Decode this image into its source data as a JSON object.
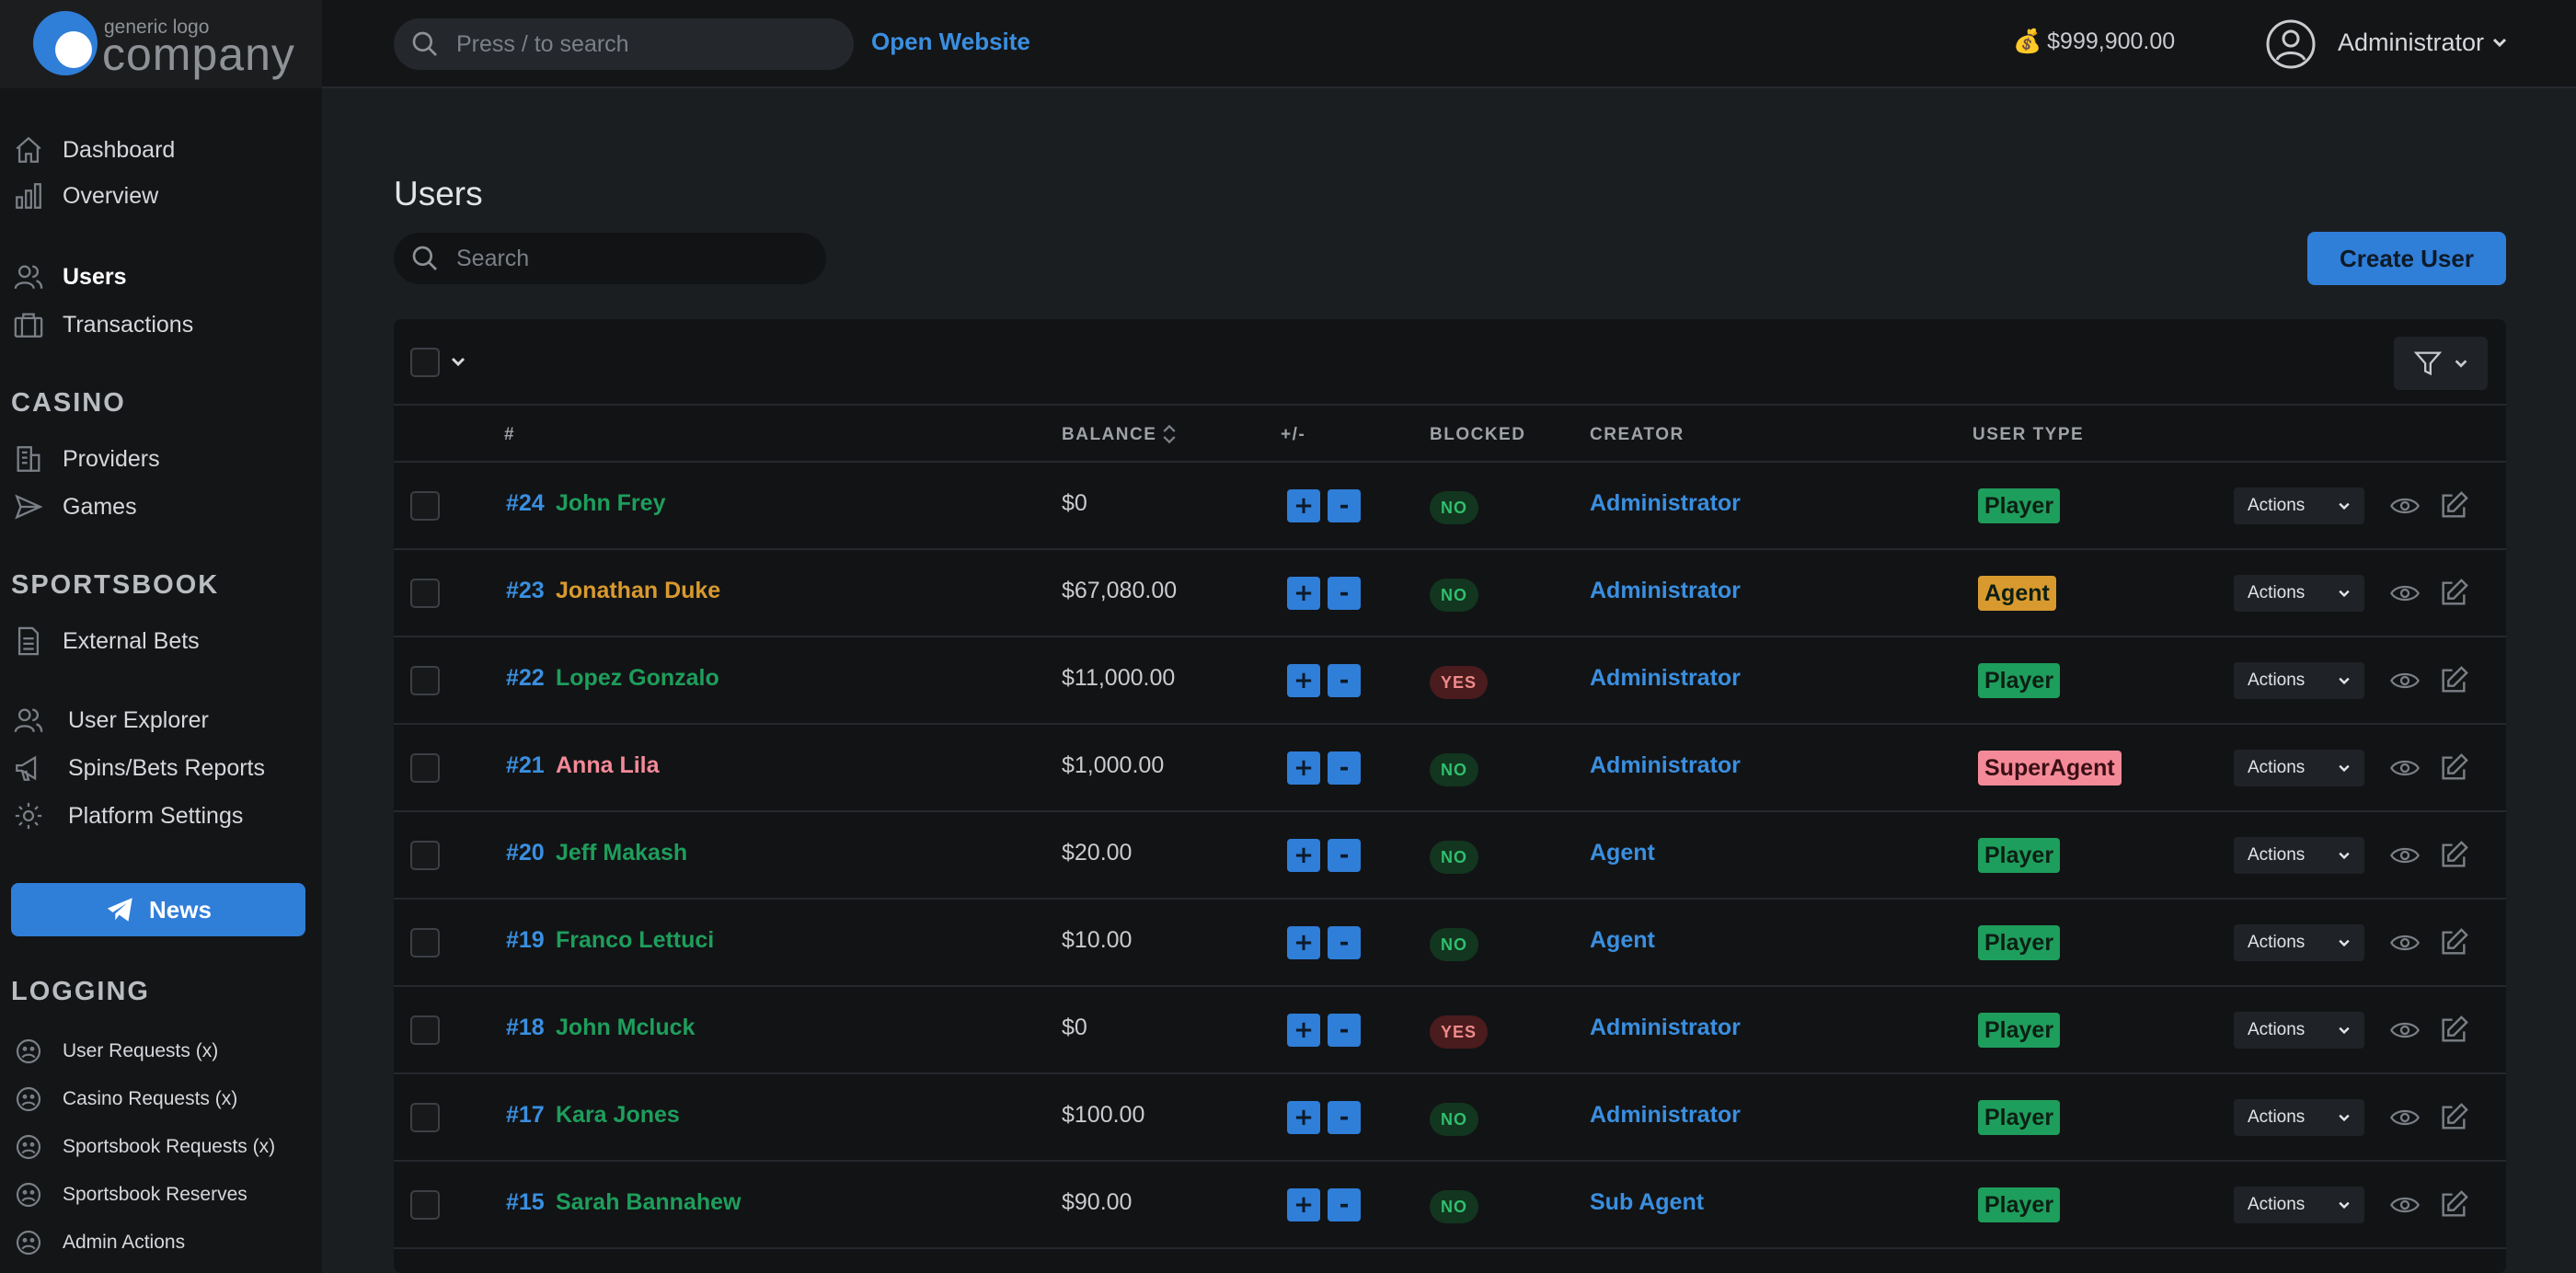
{
  "brand": {
    "small": "generic logo",
    "big": "company"
  },
  "topbar": {
    "search_placeholder": "Press / to search",
    "open_website": "Open Website",
    "balance_icon": "💰",
    "balance": "$999,900.00",
    "user_name": "Administrator"
  },
  "sidebar": {
    "main": [
      {
        "label": "Dashboard",
        "icon": "home-icon"
      },
      {
        "label": "Overview",
        "icon": "bar-chart-icon"
      },
      {
        "label": "Users",
        "icon": "users-icon",
        "active": true
      },
      {
        "label": "Transactions",
        "icon": "briefcase-icon"
      }
    ],
    "casino_title": "CASINO",
    "casino": [
      {
        "label": "Providers",
        "icon": "building-icon"
      },
      {
        "label": "Games",
        "icon": "send-icon"
      }
    ],
    "sportsbook_title": "SPORTSBOOK",
    "sportsbook": [
      {
        "label": "External Bets",
        "icon": "document-icon"
      }
    ],
    "tools": [
      {
        "label": "User Explorer",
        "icon": "users-icon"
      },
      {
        "label": "Spins/Bets Reports",
        "icon": "megaphone-icon"
      },
      {
        "label": "Platform Settings",
        "icon": "gear-icon"
      }
    ],
    "news": "News",
    "logging_title": "LOGGING",
    "logging": [
      {
        "label": "User Requests (x)",
        "icon": "face-icon"
      },
      {
        "label": "Casino Requests (x)",
        "icon": "face-icon"
      },
      {
        "label": "Sportsbook Requests (x)",
        "icon": "face-icon"
      },
      {
        "label": "Sportsbook Reserves",
        "icon": "face-icon"
      },
      {
        "label": "Admin Actions",
        "icon": "face-icon"
      }
    ]
  },
  "main": {
    "title": "Users",
    "search_placeholder": "Search",
    "create_button": "Create User"
  },
  "table": {
    "columns": {
      "id": "#",
      "balance": "BALANCE",
      "adjust": "+/-",
      "blocked": "BLOCKED",
      "creator": "CREATOR",
      "user_type": "USER TYPE"
    },
    "plus": "+",
    "minus": "-",
    "actions_label": "Actions",
    "colors": {
      "Player": "#1e9e5c",
      "Agent": "#d89a2e",
      "SuperAgent": "#f48a98",
      "blocked_no_bg": "#12361f",
      "blocked_no_fg": "#2fbf6e",
      "blocked_yes_bg": "#4a1c1e",
      "blocked_yes_fg": "#f08a8a"
    },
    "rows": [
      {
        "id": "#24",
        "name": "John Frey",
        "balance": "$0",
        "blocked": "NO",
        "creator": "Administrator",
        "user_type": "Player"
      },
      {
        "id": "#23",
        "name": "Jonathan Duke",
        "balance": "$67,080.00",
        "blocked": "NO",
        "creator": "Administrator",
        "user_type": "Agent"
      },
      {
        "id": "#22",
        "name": "Lopez Gonzalo",
        "balance": "$11,000.00",
        "blocked": "YES",
        "creator": "Administrator",
        "user_type": "Player"
      },
      {
        "id": "#21",
        "name": "Anna Lila",
        "balance": "$1,000.00",
        "blocked": "NO",
        "creator": "Administrator",
        "user_type": "SuperAgent"
      },
      {
        "id": "#20",
        "name": "Jeff Makash",
        "balance": "$20.00",
        "blocked": "NO",
        "creator": "Agent",
        "user_type": "Player"
      },
      {
        "id": "#19",
        "name": "Franco Lettuci",
        "balance": "$10.00",
        "blocked": "NO",
        "creator": "Agent",
        "user_type": "Player"
      },
      {
        "id": "#18",
        "name": "John Mcluck",
        "balance": "$0",
        "blocked": "YES",
        "creator": "Administrator",
        "user_type": "Player"
      },
      {
        "id": "#17",
        "name": "Kara Jones",
        "balance": "$100.00",
        "blocked": "NO",
        "creator": "Administrator",
        "user_type": "Player"
      },
      {
        "id": "#15",
        "name": "Sarah Bannahew",
        "balance": "$90.00",
        "blocked": "NO",
        "creator": "Sub Agent",
        "user_type": "Player"
      }
    ]
  }
}
